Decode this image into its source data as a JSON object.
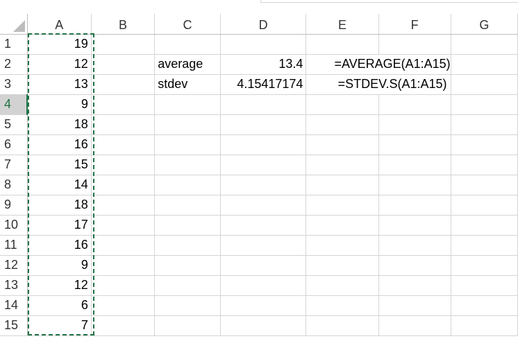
{
  "columns": [
    "A",
    "B",
    "C",
    "D",
    "E",
    "F",
    "G"
  ],
  "rows": [
    {
      "num": "1",
      "A": "19",
      "C": "",
      "D": "",
      "E": ""
    },
    {
      "num": "2",
      "A": "12",
      "C": "average",
      "D": "13.4",
      "E": "=AVERAGE(A1:A15)"
    },
    {
      "num": "3",
      "A": "13",
      "C": "stdev",
      "D": "4.15417174",
      "E": "=STDEV.S(A1:A15)"
    },
    {
      "num": "4",
      "A": "9",
      "C": "",
      "D": "",
      "E": ""
    },
    {
      "num": "5",
      "A": "18",
      "C": "",
      "D": "",
      "E": ""
    },
    {
      "num": "6",
      "A": "16",
      "C": "",
      "D": "",
      "E": ""
    },
    {
      "num": "7",
      "A": "15",
      "C": "",
      "D": "",
      "E": ""
    },
    {
      "num": "8",
      "A": "14",
      "C": "",
      "D": "",
      "E": ""
    },
    {
      "num": "9",
      "A": "18",
      "C": "",
      "D": "",
      "E": ""
    },
    {
      "num": "10",
      "A": "17",
      "C": "",
      "D": "",
      "E": ""
    },
    {
      "num": "11",
      "A": "16",
      "C": "",
      "D": "",
      "E": ""
    },
    {
      "num": "12",
      "A": "9",
      "C": "",
      "D": "",
      "E": ""
    },
    {
      "num": "13",
      "A": "12",
      "C": "",
      "D": "",
      "E": ""
    },
    {
      "num": "14",
      "A": "6",
      "C": "",
      "D": "",
      "E": ""
    },
    {
      "num": "15",
      "A": "7",
      "C": "",
      "D": "",
      "E": ""
    }
  ],
  "selection": {
    "active_row": "4",
    "copy_range": "A1:A15"
  },
  "colors": {
    "accent": "#217346",
    "gridline": "#d4d4d4",
    "header_selected_bg": "#d2d2d2"
  }
}
